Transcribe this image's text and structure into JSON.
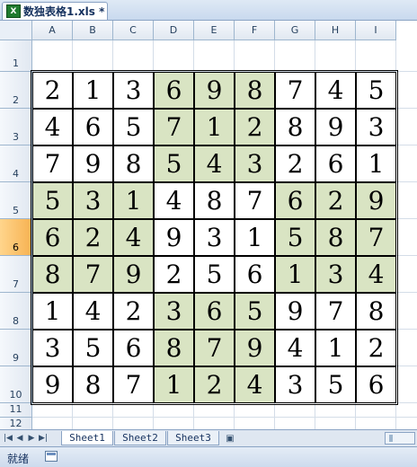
{
  "window": {
    "doc_title": "数独表格1.xls *",
    "app_icon": "excel-icon"
  },
  "columns": [
    "A",
    "B",
    "C",
    "D",
    "E",
    "F",
    "G",
    "H",
    "I"
  ],
  "rows": [
    "1",
    "2",
    "3",
    "4",
    "5",
    "6",
    "7",
    "8",
    "9",
    "10",
    "11",
    "12"
  ],
  "active_row": "6",
  "sudoku": [
    [
      "2",
      "1",
      "3",
      "6",
      "9",
      "8",
      "7",
      "4",
      "5"
    ],
    [
      "4",
      "6",
      "5",
      "7",
      "1",
      "2",
      "8",
      "9",
      "3"
    ],
    [
      "7",
      "9",
      "8",
      "5",
      "4",
      "3",
      "2",
      "6",
      "1"
    ],
    [
      "5",
      "3",
      "1",
      "4",
      "8",
      "7",
      "6",
      "2",
      "9"
    ],
    [
      "6",
      "2",
      "4",
      "9",
      "3",
      "1",
      "5",
      "8",
      "7"
    ],
    [
      "8",
      "7",
      "9",
      "2",
      "5",
      "6",
      "1",
      "3",
      "4"
    ],
    [
      "1",
      "4",
      "2",
      "3",
      "6",
      "5",
      "9",
      "7",
      "8"
    ],
    [
      "3",
      "5",
      "6",
      "8",
      "7",
      "9",
      "4",
      "1",
      "2"
    ],
    [
      "9",
      "8",
      "7",
      "1",
      "2",
      "4",
      "3",
      "5",
      "6"
    ]
  ],
  "colors": {
    "shaded_box": "#d9e4c3",
    "active_header": "#f7b252"
  },
  "sheets": {
    "tabs": [
      "Sheet1",
      "Sheet2",
      "Sheet3"
    ],
    "active": "Sheet1"
  },
  "status": {
    "ready": "就绪"
  }
}
